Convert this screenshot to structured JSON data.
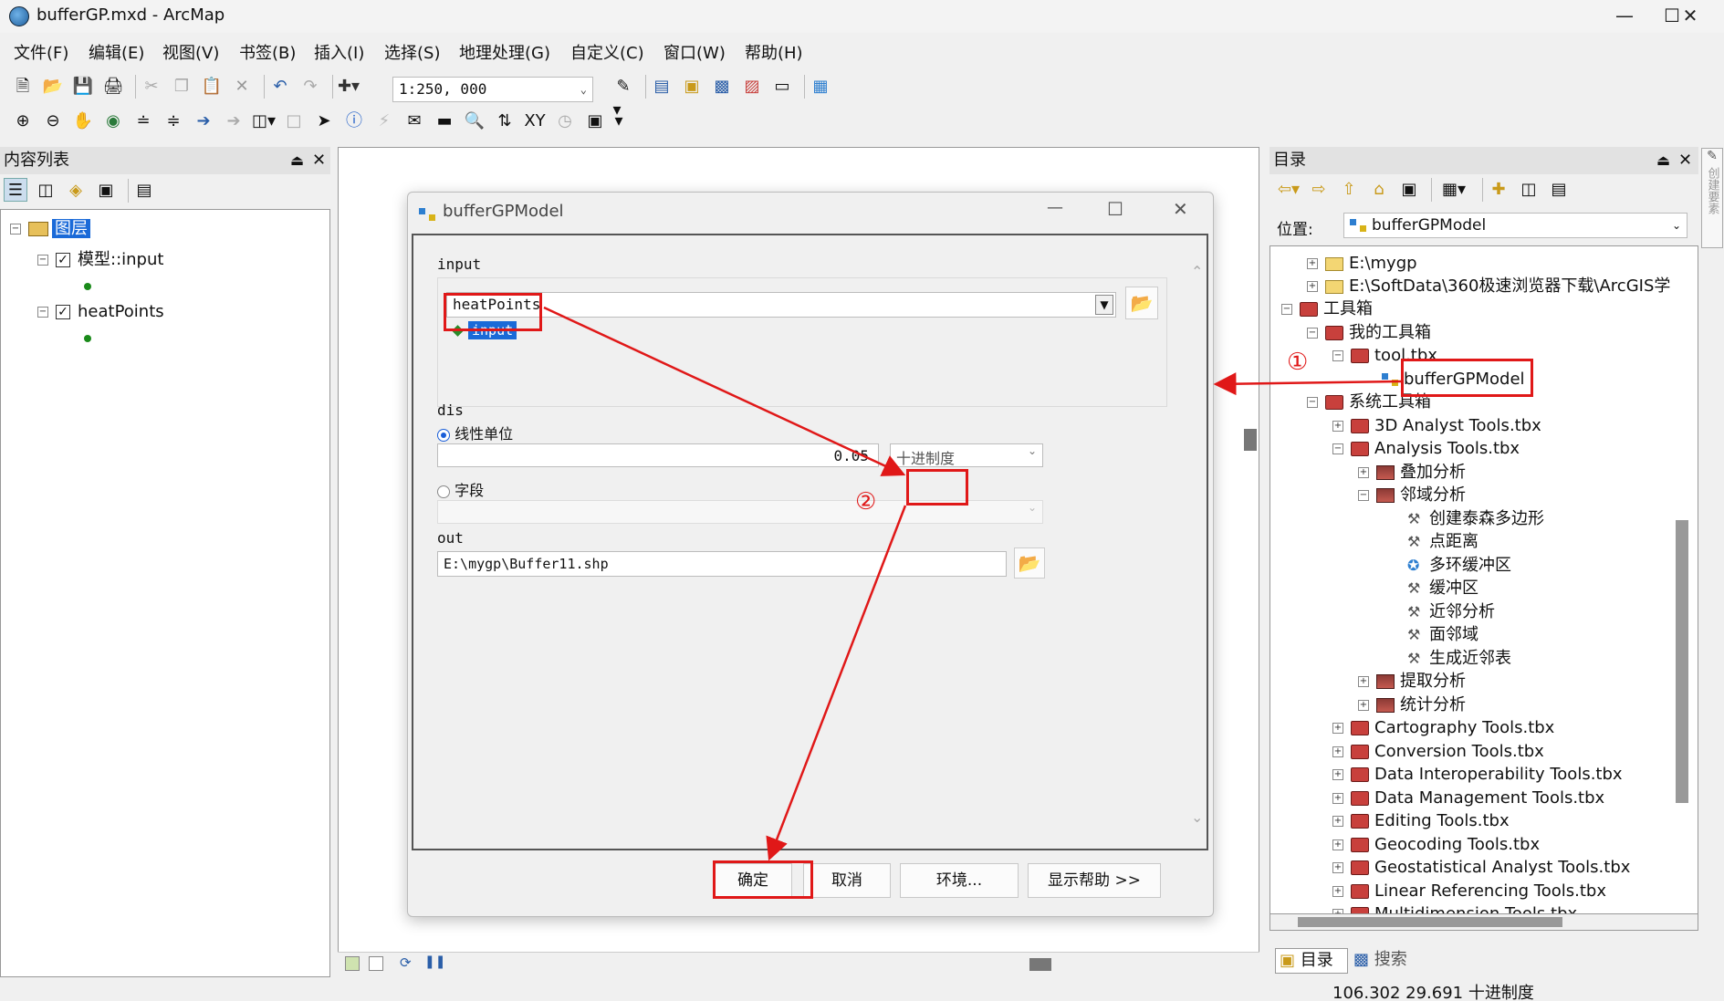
{
  "window": {
    "title": "bufferGP.mxd - ArcMap"
  },
  "menu": [
    "文件(F)",
    "编辑(E)",
    "视图(V)",
    "书签(B)",
    "插入(I)",
    "选择(S)",
    "地理处理(G)",
    "自定义(C)",
    "窗口(W)",
    "帮助(H)"
  ],
  "toolbar": {
    "scale": "1:250, 000"
  },
  "toc": {
    "title": "内容列表",
    "root": "图层",
    "layers": [
      "模型::input",
      "heatPoints"
    ]
  },
  "dialog": {
    "title": "bufferGPModel",
    "input_label": "input",
    "input_value": "heatPoints",
    "input_variable": "input",
    "dis_label": "dis",
    "radio_linear": "线性单位",
    "distance_value": "0.05",
    "unit_value": "十进制度",
    "radio_field": "字段",
    "out_label": "out",
    "out_value": "E:\\mygp\\Buffer11.shp",
    "btn_ok": "确定",
    "btn_cancel": "取消",
    "btn_env": "环境...",
    "btn_help": "显示帮助 >>"
  },
  "annotations": {
    "step1": "①",
    "step2": "②",
    "color": "#e01818"
  },
  "catalog": {
    "title": "目录",
    "location_label": "位置:",
    "location_value": "bufferGPModel",
    "tree": {
      "folder1": "E:\\mygp",
      "folder2": "E:\\SoftData\\360极速浏览器下载\\ArcGIS学",
      "toolboxes": "工具箱",
      "my_toolboxes": "我的工具箱",
      "tool_tbx": "tool.tbx",
      "model": "bufferGPModel",
      "system_toolboxes": "系统工具箱",
      "analyst3d": "3D Analyst Tools.tbx",
      "analysis": "Analysis Tools.tbx",
      "overlay": "叠加分析",
      "proximity": "邻域分析",
      "thiessen": "创建泰森多边形",
      "point_distance": "点距离",
      "multiring": "多环缓冲区",
      "buffer": "缓冲区",
      "near": "近邻分析",
      "polygon_neighbors": "面邻域",
      "near_table": "生成近邻表",
      "extract": "提取分析",
      "statistics": "统计分析",
      "cartography": "Cartography Tools.tbx",
      "conversion": "Conversion Tools.tbx",
      "interop": "Data Interoperability Tools.tbx",
      "datamgmt": "Data Management Tools.tbx",
      "editing": "Editing Tools.tbx",
      "geocoding": "Geocoding Tools.tbx",
      "geostat": "Geostatistical Analyst Tools.tbx",
      "linref": "Linear Referencing Tools.tbx",
      "multidim": "Multidimension Tools.tbx"
    },
    "tab_catalog": "目录",
    "tab_search": "搜索",
    "side_tab": "创建要素"
  },
  "status": {
    "coords": "106.302  29.691 十进制度"
  }
}
